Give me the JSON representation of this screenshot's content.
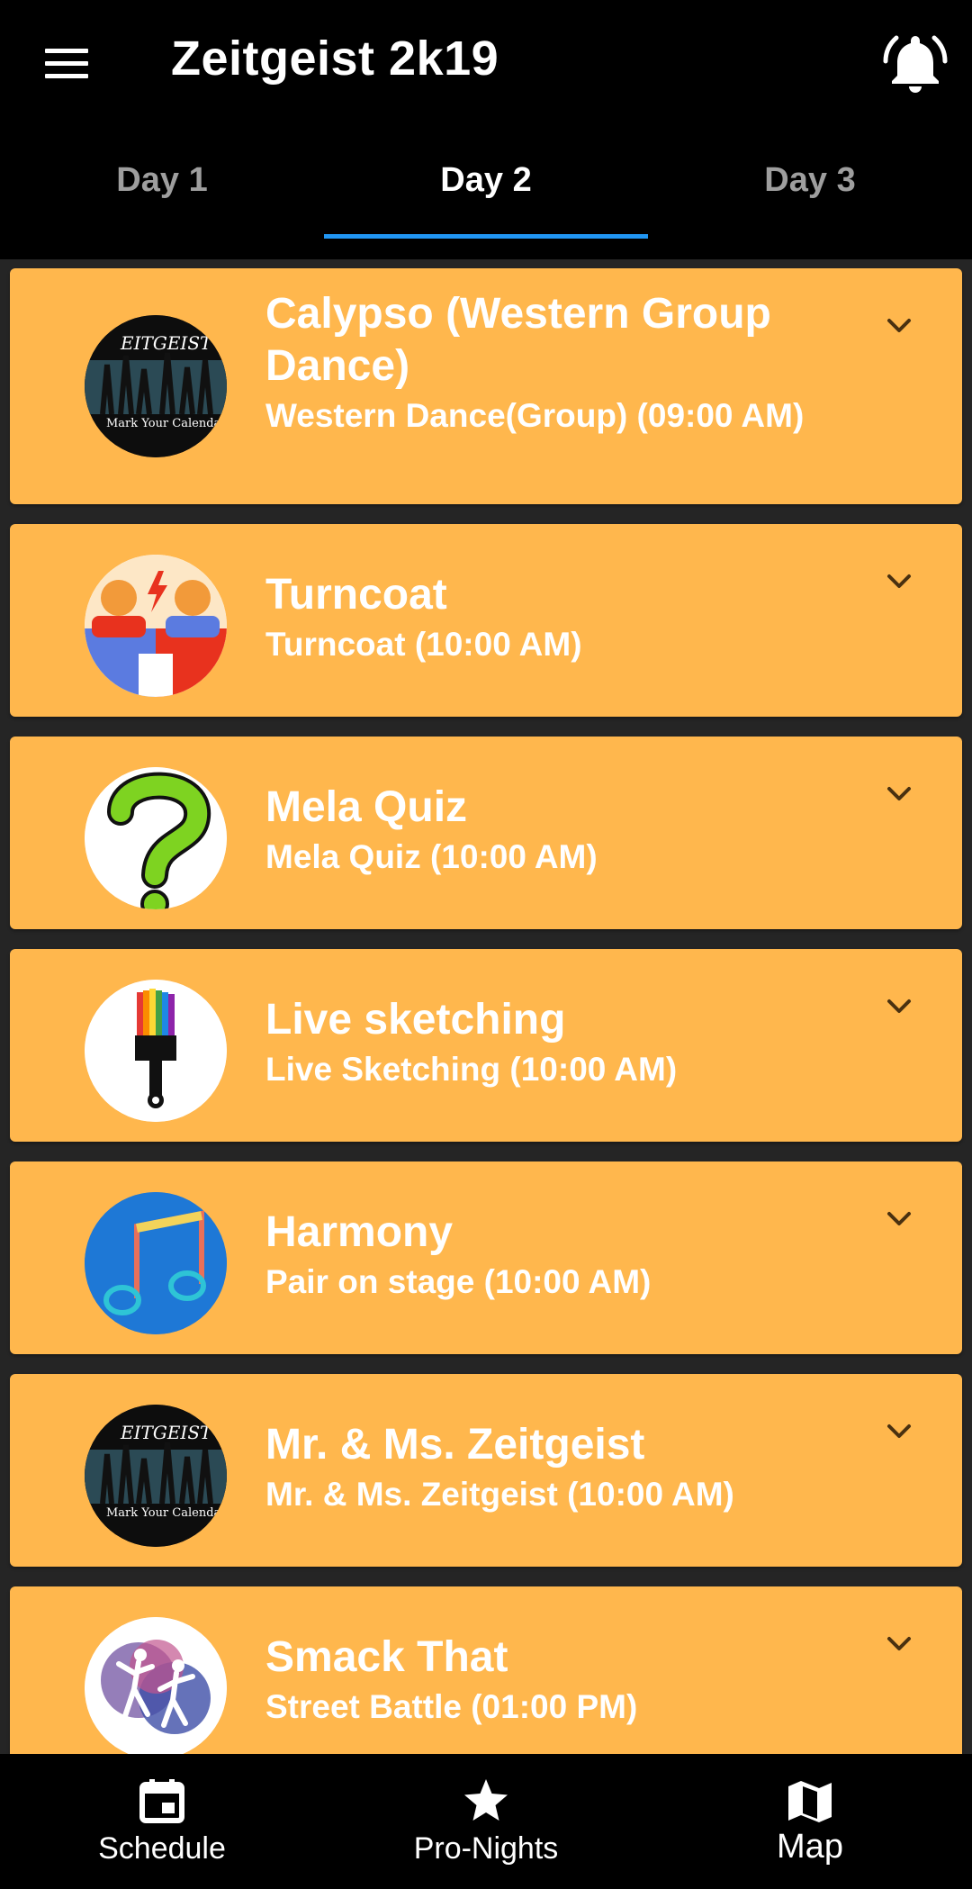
{
  "app_title": "Zeitgeist 2k19",
  "tabs": [
    {
      "label": "Day 1"
    },
    {
      "label": "Day 2"
    },
    {
      "label": "Day 3"
    }
  ],
  "events": [
    {
      "title": "Calypso (Western Group Dance)",
      "subtitle": "Western Dance(Group) (09:00 AM)",
      "image": "zeitgeist-poster"
    },
    {
      "title": "Turncoat",
      "subtitle": "Turncoat (10:00 AM)",
      "image": "debate-people"
    },
    {
      "title": "Mela Quiz",
      "subtitle": "Mela Quiz (10:00 AM)",
      "image": "question-mark"
    },
    {
      "title": "Live sketching",
      "subtitle": "Live Sketching (10:00 AM)",
      "image": "paintbrush"
    },
    {
      "title": "Harmony",
      "subtitle": "Pair on stage (10:00 AM)",
      "image": "music-note"
    },
    {
      "title": "Mr. & Ms. Zeitgeist",
      "subtitle": "Mr. & Ms. Zeitgeist (10:00 AM)",
      "image": "zeitgeist-poster"
    },
    {
      "title": "Smack That",
      "subtitle": "Street Battle (01:00 PM)",
      "image": "dancers"
    }
  ],
  "bottom_nav": [
    {
      "label": "Schedule",
      "icon": "calendar-icon"
    },
    {
      "label": "Pro-Nights",
      "icon": "star-icon"
    },
    {
      "label": "Map",
      "icon": "map-icon"
    }
  ],
  "colors": {
    "card": "#ffb74d",
    "background": "#252525",
    "tab_indicator": "#2196f3",
    "bar": "#000000"
  }
}
